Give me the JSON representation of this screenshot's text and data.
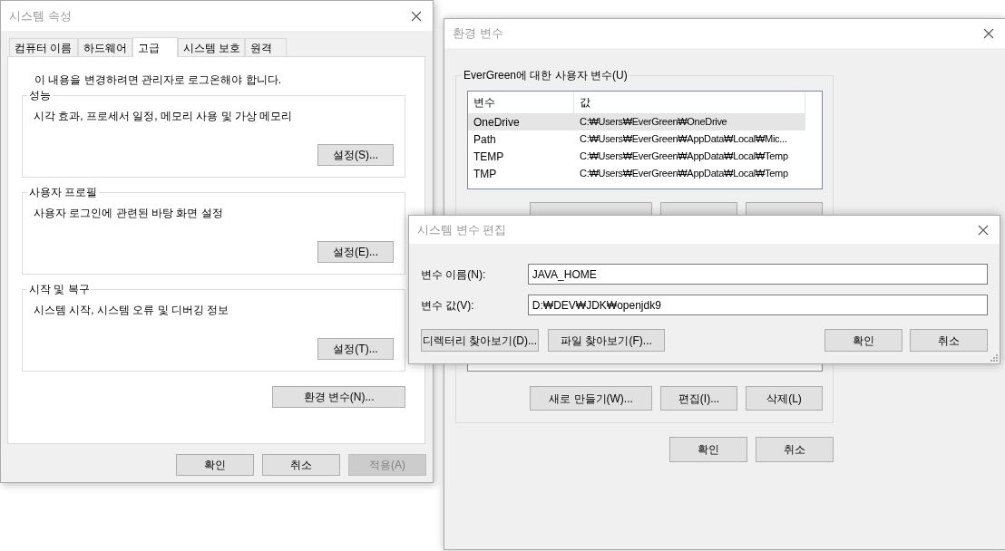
{
  "system_properties": {
    "title": "시스템 속성",
    "tabs": [
      {
        "label": "컴퓨터 이름",
        "selected": false
      },
      {
        "label": "하드웨어",
        "selected": false
      },
      {
        "label": "고급",
        "selected": true
      },
      {
        "label": "시스템 보호",
        "selected": false
      },
      {
        "label": "원격",
        "selected": false
      }
    ],
    "notice": "이 내용을 변경하려면 관리자로 로그온해야 합니다.",
    "groups": [
      {
        "title": "성능",
        "description": "시각 효과, 프로세서 일정, 메모리 사용 및 가상 메모리",
        "button": "설정(S)..."
      },
      {
        "title": "사용자 프로필",
        "description": "사용자 로그인에 관련된 바탕 화면 설정",
        "button": "설정(E)..."
      },
      {
        "title": "시작 및 복구",
        "description": "시스템 시작, 시스템 오류 및 디버깅 정보",
        "button": "설정(T)..."
      }
    ],
    "env_button": "환경 변수(N)...",
    "buttons": [
      {
        "label": "확인",
        "disabled": false
      },
      {
        "label": "취소",
        "disabled": false
      },
      {
        "label": "적용(A)",
        "disabled": true
      }
    ]
  },
  "environment_variables": {
    "title": "환경 변수",
    "user_variables": {
      "title": "EverGreen에 대한 사용자 변수(U)",
      "columns": [
        "변수",
        "값"
      ],
      "rows": [
        {
          "name": "OneDrive",
          "value": "C:₩Users₩EverGreen₩OneDrive",
          "selected": true
        },
        {
          "name": "Path",
          "value": "C:₩Users₩EverGreen₩AppData₩Local₩Mic...",
          "selected": false
        },
        {
          "name": "TEMP",
          "value": "C:₩Users₩EverGreen₩AppData₩Local₩Temp",
          "selected": false
        },
        {
          "name": "TMP",
          "value": "C:₩Users₩EverGreen₩AppData₩Local₩Temp",
          "selected": false
        }
      ]
    },
    "system_variables": {
      "buttons": [
        "새로 만들기(W)...",
        "편집(I)...",
        "삭제(L)"
      ]
    },
    "buttons": [
      "확인",
      "취소"
    ]
  },
  "edit_dialog": {
    "title": "시스템 변수 편집",
    "fields": [
      {
        "label": "변수 이름(N):",
        "value": "JAVA_HOME"
      },
      {
        "label": "변수 값(V):",
        "value": "D:₩DEV₩JDK₩openjdk9"
      }
    ],
    "browse_buttons": [
      "디렉터리 찾아보기(D)...",
      "파일 찾아보기(F)..."
    ],
    "buttons": [
      "확인",
      "취소"
    ]
  }
}
